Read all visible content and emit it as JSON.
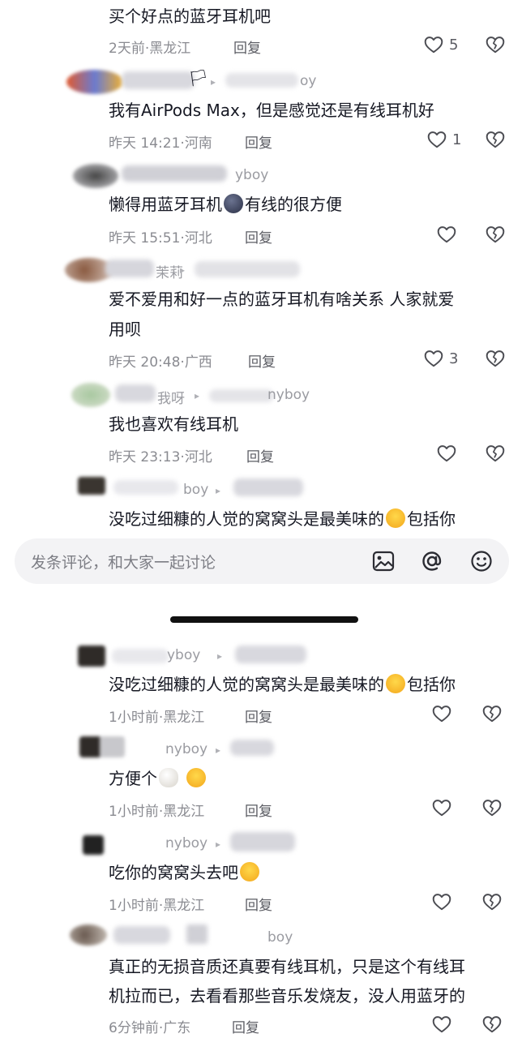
{
  "comments_top": [
    {
      "text": "买个好点的蓝牙耳机吧",
      "time": "2天前",
      "location": "黑龙江",
      "reply": "回复",
      "likes": "5"
    },
    {
      "username_partial": "oy",
      "text": "我有AirPods Max，但是感觉还是有线耳机好",
      "time": "昨天 14:21",
      "location": "河南",
      "reply": "回复",
      "likes": "1"
    },
    {
      "username_partial": "yboy",
      "text_before": "懒得用蓝牙耳机",
      "text_after": "有线的很方便",
      "time": "昨天 15:51",
      "location": "河北",
      "reply": "回复",
      "likes": ""
    },
    {
      "username_partial": "茉莉",
      "text_line1": "爱不爱用和好一点的蓝牙耳机有啥关系 人家就爱",
      "text_line2": "用呗",
      "time": "昨天 20:48",
      "location": "广西",
      "reply": "回复",
      "likes": "3"
    },
    {
      "username_partial": "我呀",
      "username_tail": "nyboy",
      "text": "我也喜欢有线耳机",
      "time": "昨天 23:13",
      "location": "河北",
      "reply": "回复",
      "likes": ""
    },
    {
      "username_partial": "boy",
      "text_before": "没吃过细糠的人觉的窝窝头是最美味的",
      "text_after": "包括你"
    }
  ],
  "input_bar": {
    "placeholder": "发条评论，和大家一起讨论",
    "icons": [
      "image-icon",
      "at-icon",
      "emoji-icon"
    ]
  },
  "comments_bottom": [
    {
      "username_partial": "yboy",
      "text_before": "没吃过细糠的人觉的窝窝头是最美味的",
      "text_after": "包括你",
      "time": "1小时前",
      "location": "黑龙江",
      "reply": "回复"
    },
    {
      "username_partial": "nyboy",
      "text_before": "方便个",
      "time": "1小时前",
      "location": "黑龙江",
      "reply": "回复"
    },
    {
      "username_partial": "nyboy",
      "text_before": "吃你的窝窝头去吧",
      "time": "1小时前",
      "location": "黑龙江",
      "reply": "回复"
    },
    {
      "username_partial": "boy",
      "text_line1": "真正的无损音质还真要有线耳机，只是这个有线耳",
      "text_line2": "机拉而已，去看看那些音乐发烧友，没人用蓝牙的",
      "time": "6分钟前",
      "location": "广东",
      "reply": "回复"
    }
  ],
  "separator": "·",
  "colors": {
    "text": "#161823",
    "meta": "#8a8b91",
    "icon": "#4b4c52",
    "bar": "#f3f3f5"
  }
}
